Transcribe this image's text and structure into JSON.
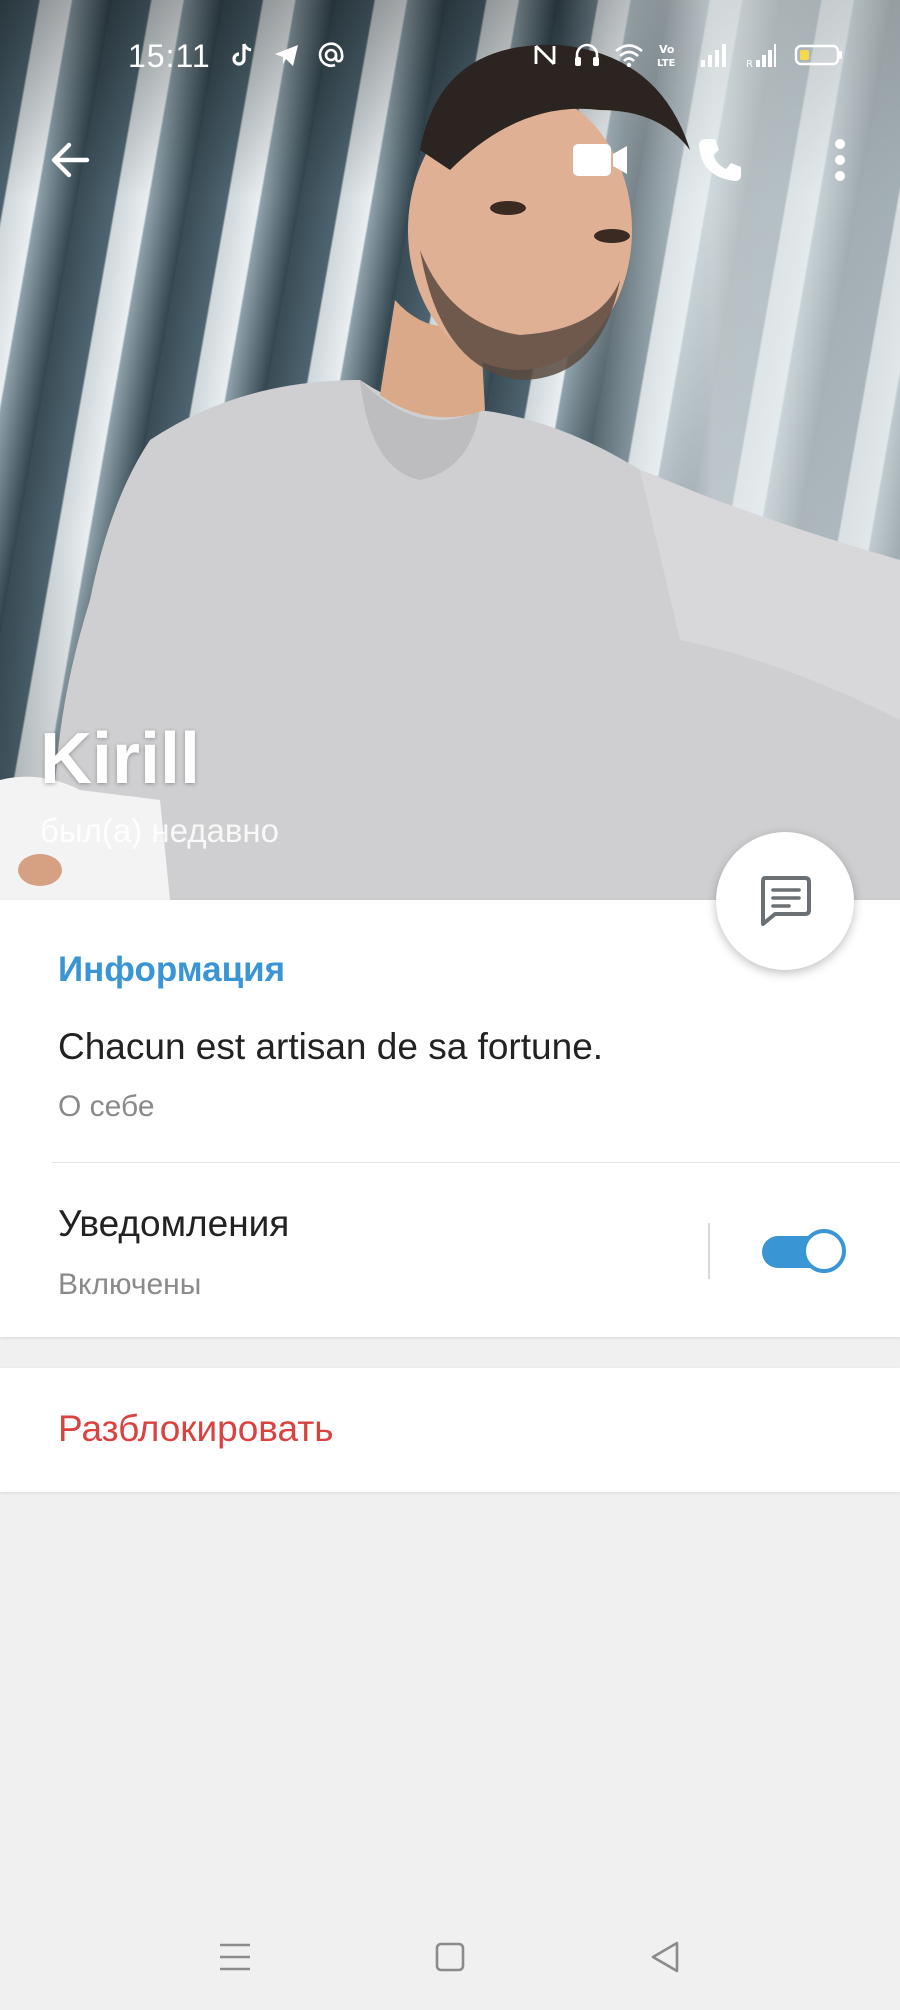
{
  "status_bar": {
    "time": "15:11",
    "left_icons": [
      "tiktok-icon",
      "telegram-icon",
      "at-icon"
    ],
    "right_icons": [
      "nfc-icon",
      "headset-icon",
      "wifi-icon",
      "volte-icon",
      "signal-icon",
      "roaming-signal-icon",
      "battery-icon"
    ],
    "battery_level": 0.25
  },
  "toolbar": {
    "back_icon": "arrow-left-icon",
    "video_icon": "video-camera-icon",
    "call_icon": "phone-icon",
    "menu_icon": "more-vert-icon"
  },
  "profile": {
    "name": "Kirill",
    "last_seen": "был(а) недавно"
  },
  "fab": {
    "icon": "message-icon"
  },
  "info_section": {
    "header": "Информация",
    "bio_text": "Chacun est artisan de sa fortune.",
    "bio_label": "О себе",
    "notifications_title": "Уведомления",
    "notifications_status": "Включены",
    "notifications_enabled": true
  },
  "actions": {
    "unblock_label": "Разблокировать"
  },
  "nav_bar": {
    "icons": [
      "menu-icon",
      "home-square-icon",
      "back-triangle-icon"
    ]
  },
  "colors": {
    "accent": "#3a95d5",
    "danger": "#d9423f",
    "background": "#f0f0f0"
  }
}
